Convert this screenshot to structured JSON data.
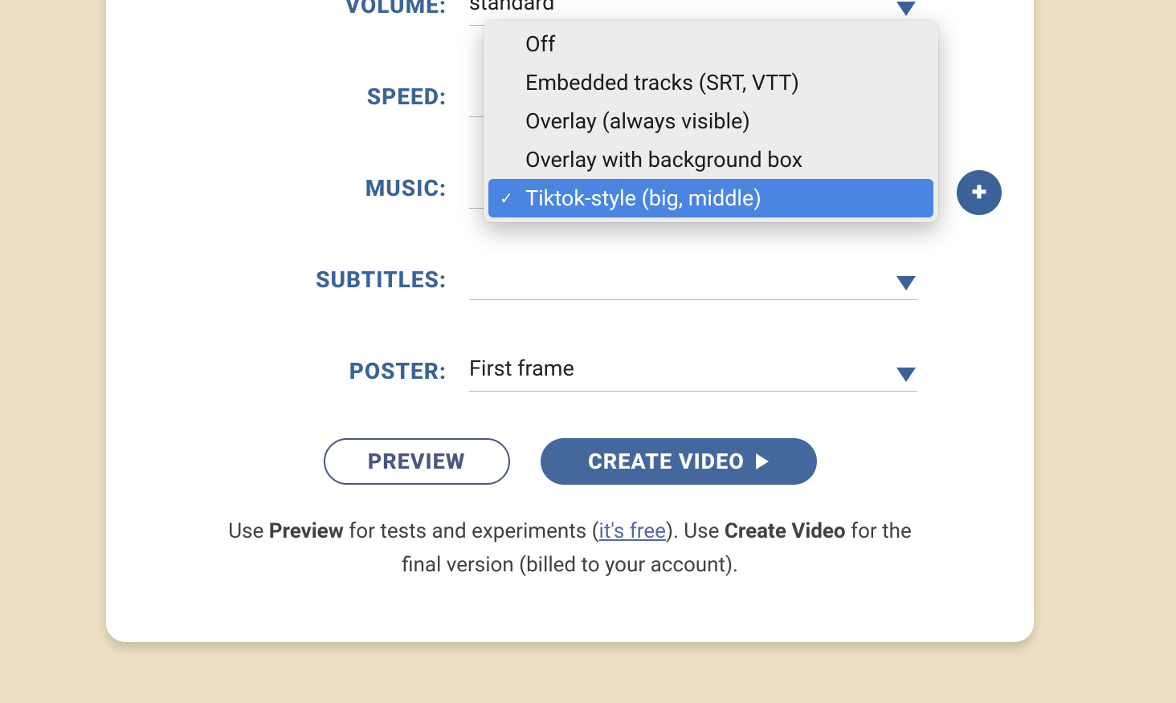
{
  "form": {
    "volume": {
      "label": "VOLUME:",
      "value": "standard"
    },
    "speed": {
      "label": "SPEED:",
      "value": ""
    },
    "music": {
      "label": "MUSIC:",
      "value": ""
    },
    "subtitles": {
      "label": "SUBTITLES:",
      "value": "",
      "options": [
        "Off",
        "Embedded tracks (SRT, VTT)",
        "Overlay (always visible)",
        "Overlay with background box",
        "Tiktok-style (big, middle)"
      ],
      "selected_index": 4
    },
    "poster": {
      "label": "POSTER:",
      "value": "First frame"
    }
  },
  "buttons": {
    "preview": "PREVIEW",
    "create": "CREATE VIDEO"
  },
  "hint": {
    "use1": "Use ",
    "preview_bold": "Preview",
    "mid1": " for tests and experiments (",
    "free_link": "it's free",
    "mid2": "). Use ",
    "create_bold": "Create Video",
    "end": " for the final version (billed to your account)."
  }
}
